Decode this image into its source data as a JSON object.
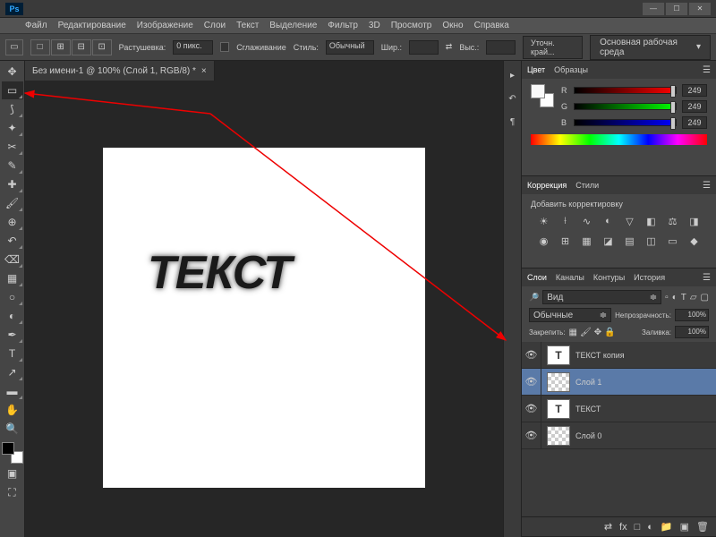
{
  "menu": [
    "Файл",
    "Редактирование",
    "Изображение",
    "Слои",
    "Текст",
    "Выделение",
    "Фильтр",
    "3D",
    "Просмотр",
    "Окно",
    "Справка"
  ],
  "options": {
    "feather_label": "Растушевка:",
    "feather_value": "0 пикс.",
    "smooth_label": "Сглаживание",
    "style_label": "Стиль:",
    "style_value": "Обычный",
    "width_label": "Шир.:",
    "height_label": "Выс.:",
    "refine": "Уточн. край...",
    "workspace": "Основная рабочая среда"
  },
  "document": {
    "tab": "Без имени-1 @ 100% (Слой 1, RGB/8) *",
    "text": "ТЕКСТ"
  },
  "panels": {
    "color_tab": "Цвет",
    "swatches_tab": "Образцы",
    "r": "R",
    "g": "G",
    "b": "B",
    "r_val": "249",
    "g_val": "249",
    "b_val": "249",
    "corrections_tab": "Коррекция",
    "styles_tab": "Стили",
    "add_correction": "Добавить корректировку",
    "layers_tab": "Слои",
    "channels_tab": "Каналы",
    "paths_tab": "Контуры",
    "history_tab": "История",
    "kind_label": "Вид",
    "blend_mode": "Обычные",
    "opacity_label": "Непрозрачность:",
    "opacity_val": "100%",
    "lock_label": "Закрепить:",
    "fill_label": "Заливка:",
    "fill_val": "100%"
  },
  "layers": [
    {
      "name": "ТЕКСТ копия",
      "type": "T"
    },
    {
      "name": "Слой 1",
      "type": "raster",
      "selected": true
    },
    {
      "name": "ТЕКСТ",
      "type": "T"
    },
    {
      "name": "Слой 0",
      "type": "raster"
    }
  ]
}
